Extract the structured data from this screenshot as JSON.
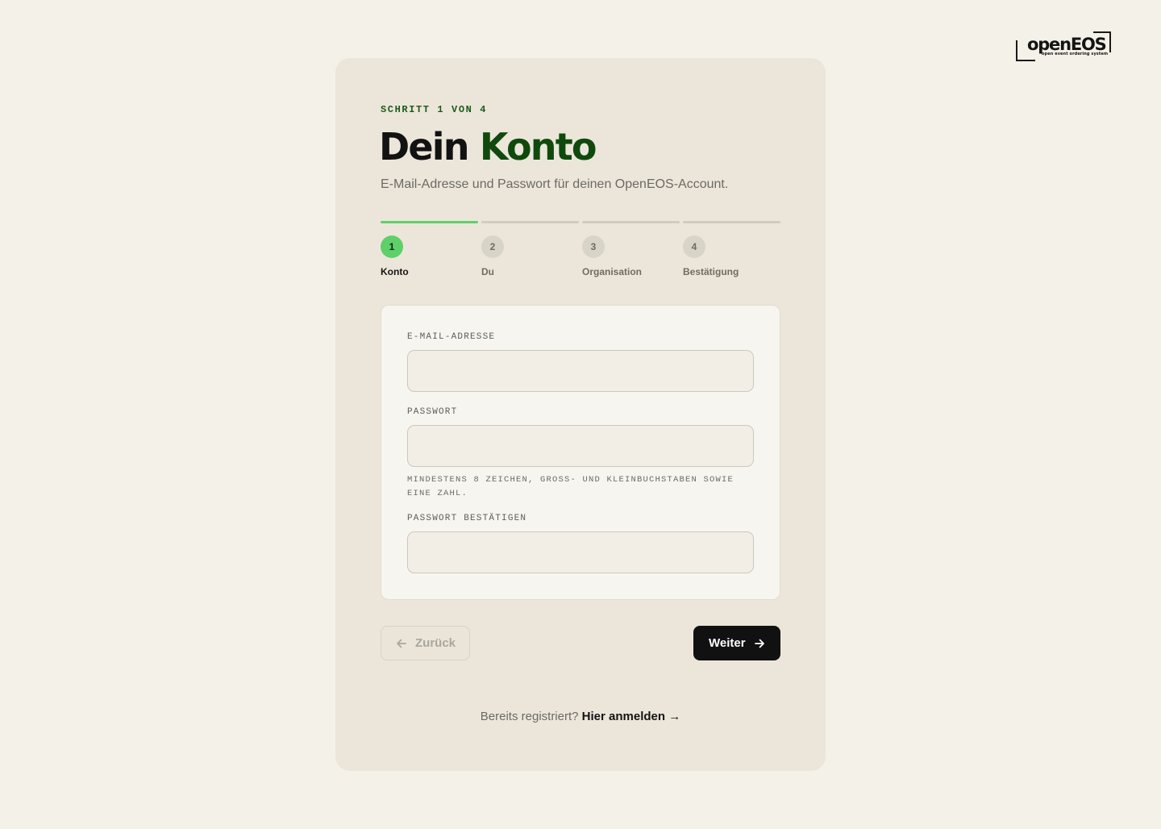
{
  "brand": {
    "logo_text": "openEOS",
    "logo_tagline": "open event ordering system"
  },
  "header": {
    "eyebrow": "SCHRITT 1 VON 4",
    "title_plain": "Dein ",
    "title_accent": "Konto",
    "subtitle": "E-Mail-Adresse und Passwort für deinen OpenEOS-Account."
  },
  "stepper": {
    "current": 1,
    "total": 4,
    "steps": [
      {
        "number": "1",
        "label": "Konto",
        "state": "active"
      },
      {
        "number": "2",
        "label": "Du",
        "state": "upcoming"
      },
      {
        "number": "3",
        "label": "Organisation",
        "state": "upcoming"
      },
      {
        "number": "4",
        "label": "Bestätigung",
        "state": "upcoming"
      }
    ]
  },
  "form": {
    "email_label": "E-MAIL-ADRESSE",
    "email_value": "",
    "password_label": "PASSWORT",
    "password_value": "",
    "password_hint": "MINDESTENS 8 ZEICHEN, GROSS- UND KLEINBUCHSTABEN SOWIE EINE ZAHL.",
    "confirm_label": "PASSWORT BESTÄTIGEN",
    "confirm_value": ""
  },
  "actions": {
    "back_label": "Zurück",
    "back_disabled": true,
    "next_label": "Weiter"
  },
  "footer": {
    "prompt": "Bereits registriert?",
    "login_link": "Hier anmelden →"
  },
  "colors": {
    "background": "#f4f1e9",
    "card": "#ece6da",
    "accent_green": "#5fcf6a",
    "title_accent": "#0f4a0c",
    "primary_button": "#111111"
  }
}
